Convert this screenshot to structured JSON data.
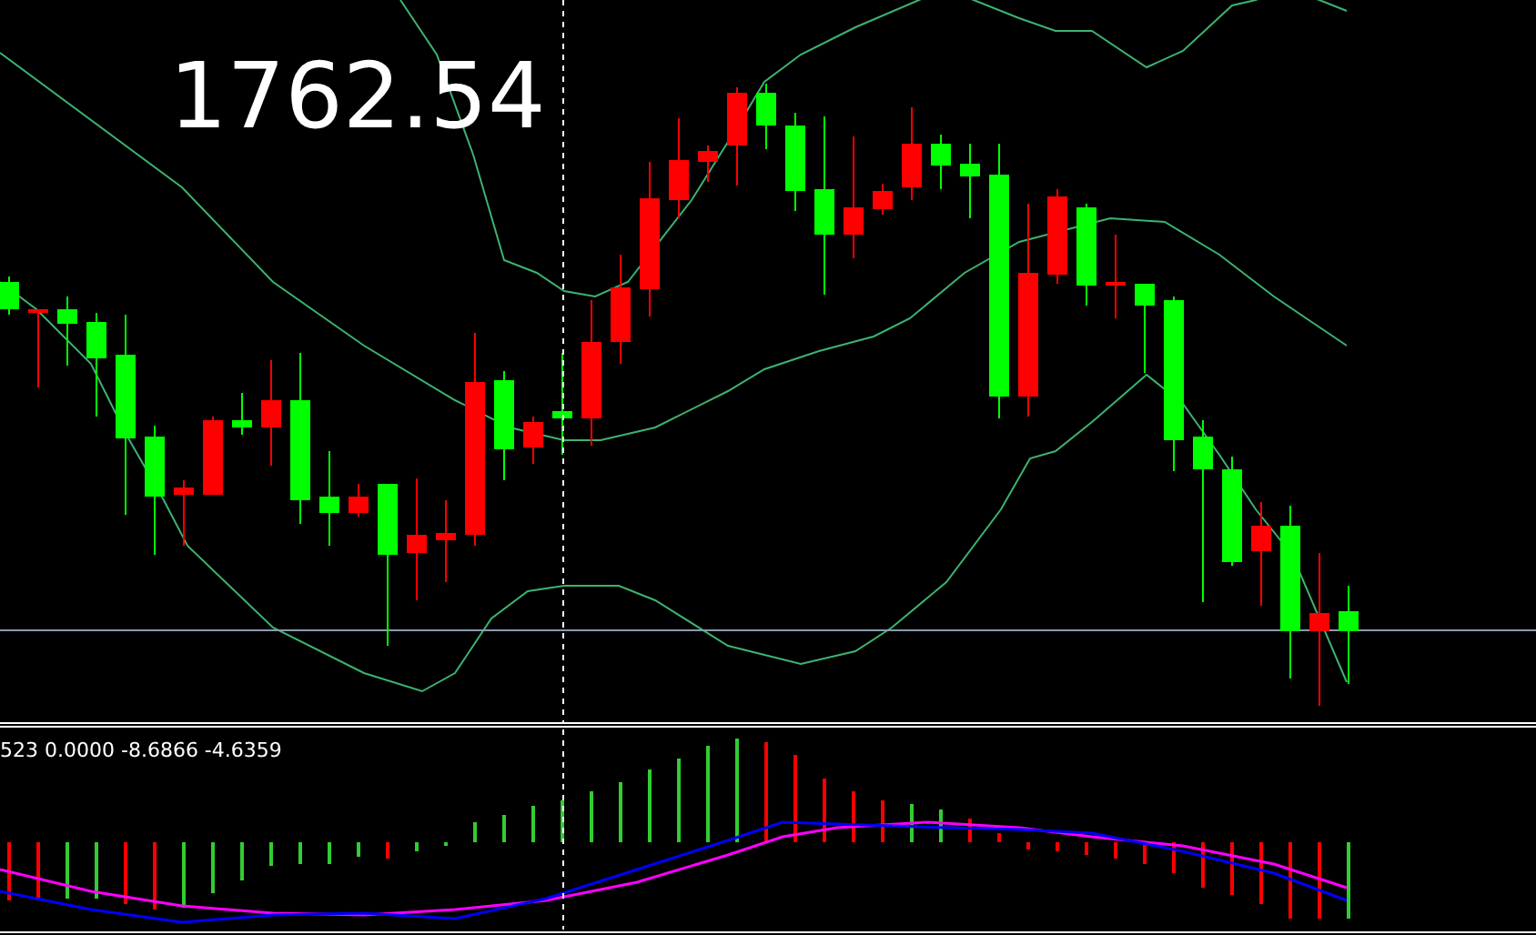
{
  "price_chart": {
    "price_label": "1762.54"
  },
  "indicator": {
    "readout": "523 0.0000 -8.6866 -4.6359"
  }
}
